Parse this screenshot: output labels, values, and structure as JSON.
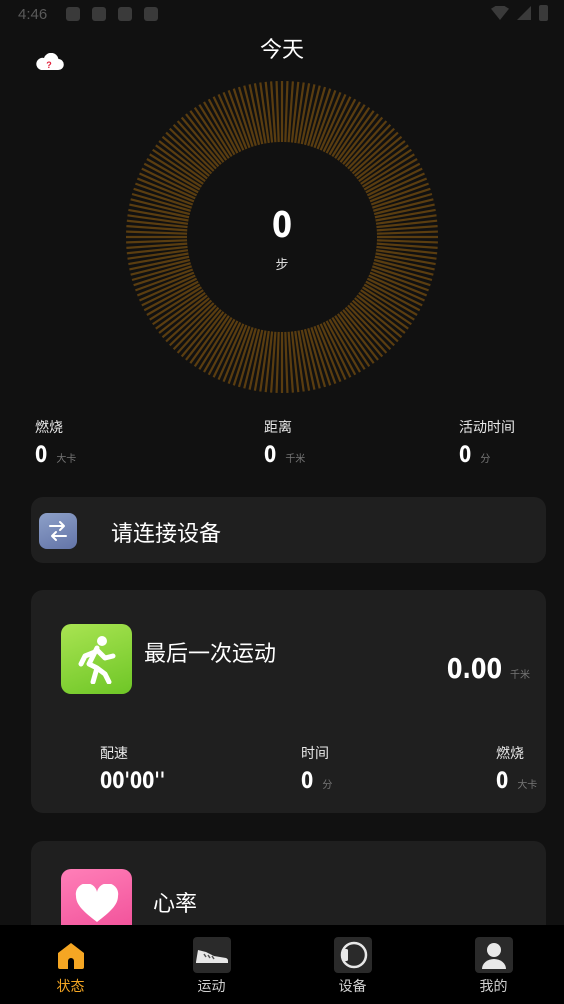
{
  "status_bar": {
    "time": "4:46"
  },
  "header": {
    "title": "今天"
  },
  "ring": {
    "steps_value": "0",
    "steps_unit": "步",
    "progress": 0
  },
  "stats": [
    {
      "label": "燃烧",
      "value": "0",
      "unit": "大卡"
    },
    {
      "label": "距离",
      "value": "0",
      "unit": "千米"
    },
    {
      "label": "活动时间",
      "value": "0",
      "unit": "分"
    }
  ],
  "connect_card": {
    "text": "请连接设备"
  },
  "workout_card": {
    "title": "最后一次运动",
    "distance_value": "0.00",
    "distance_unit": "千米",
    "stats": [
      {
        "label": "配速",
        "value": "00'00''",
        "unit": ""
      },
      {
        "label": "时间",
        "value": "0",
        "unit": "分"
      },
      {
        "label": "燃烧",
        "value": "0",
        "unit": "大卡"
      }
    ]
  },
  "heart_card": {
    "title": "心率"
  },
  "bottom_nav": [
    {
      "label": "状态",
      "icon": "home-icon",
      "active": true
    },
    {
      "label": "运动",
      "icon": "shoe-icon",
      "active": false
    },
    {
      "label": "设备",
      "icon": "watch-icon",
      "active": false
    },
    {
      "label": "我的",
      "icon": "person-icon",
      "active": false
    }
  ],
  "colors": {
    "accent": "#f5a623",
    "ring": "#5a3d10",
    "background": "#111111",
    "card": "#1f1f1f"
  }
}
